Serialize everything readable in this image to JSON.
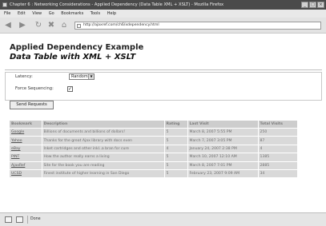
{
  "window": {
    "title": "Chapter 6 : Networking Considerations - Applied Dependency (Data Table XML + XSLT) - Mozilla Firefox",
    "controls": [
      "_",
      "□",
      "×"
    ]
  },
  "menubar": {
    "items": [
      "File",
      "Edit",
      "View",
      "Go",
      "Bookmarks",
      "Tools",
      "Help"
    ]
  },
  "toolbar": {
    "buttons": [
      "back-icon",
      "forward-icon",
      "reload-icon",
      "stop-icon",
      "home-icon"
    ],
    "address_url": "http://ajaxref.com/ch6/xdependency.html"
  },
  "page": {
    "heading": "Applied Dependency Example",
    "subheading": "Data Table with XML + XSLT",
    "latency_label": "Latency:",
    "latency_value": "Random",
    "force_label": "Force Sequencing:",
    "force_checked": "✓",
    "send_button": "Send Requests"
  },
  "table": {
    "headers": [
      "Bookmark",
      "Description",
      "Rating",
      "Last Visit",
      "Total Visits"
    ],
    "rows": [
      [
        "Google",
        "Billions of documents and billions of dollars!",
        "5",
        "March 8, 2007 5:55 PM",
        "250"
      ],
      [
        "Yahoo",
        "Thanks for the great Ajax library with docs even",
        "5",
        "March 7, 2007 3:05 PM",
        "87"
      ],
      [
        "eBay",
        "Inket cartridges and other inkl..a bran for cure",
        "4",
        "January 24, 2007 2:38 PM",
        "4"
      ],
      [
        "PINT",
        "How the author really earns a living",
        "5",
        "March 10, 2007 12:10 AM",
        "1385"
      ],
      [
        "AjaxRef",
        "Site for the book you are reading",
        "5",
        "March 8, 2007 7:01 PM",
        "2885"
      ],
      [
        "UCSD",
        "Finest institute of higher learning in San Diego",
        "5",
        "February 23, 2007 9:09 AM",
        "34"
      ]
    ]
  },
  "status": {
    "text": "Done"
  }
}
